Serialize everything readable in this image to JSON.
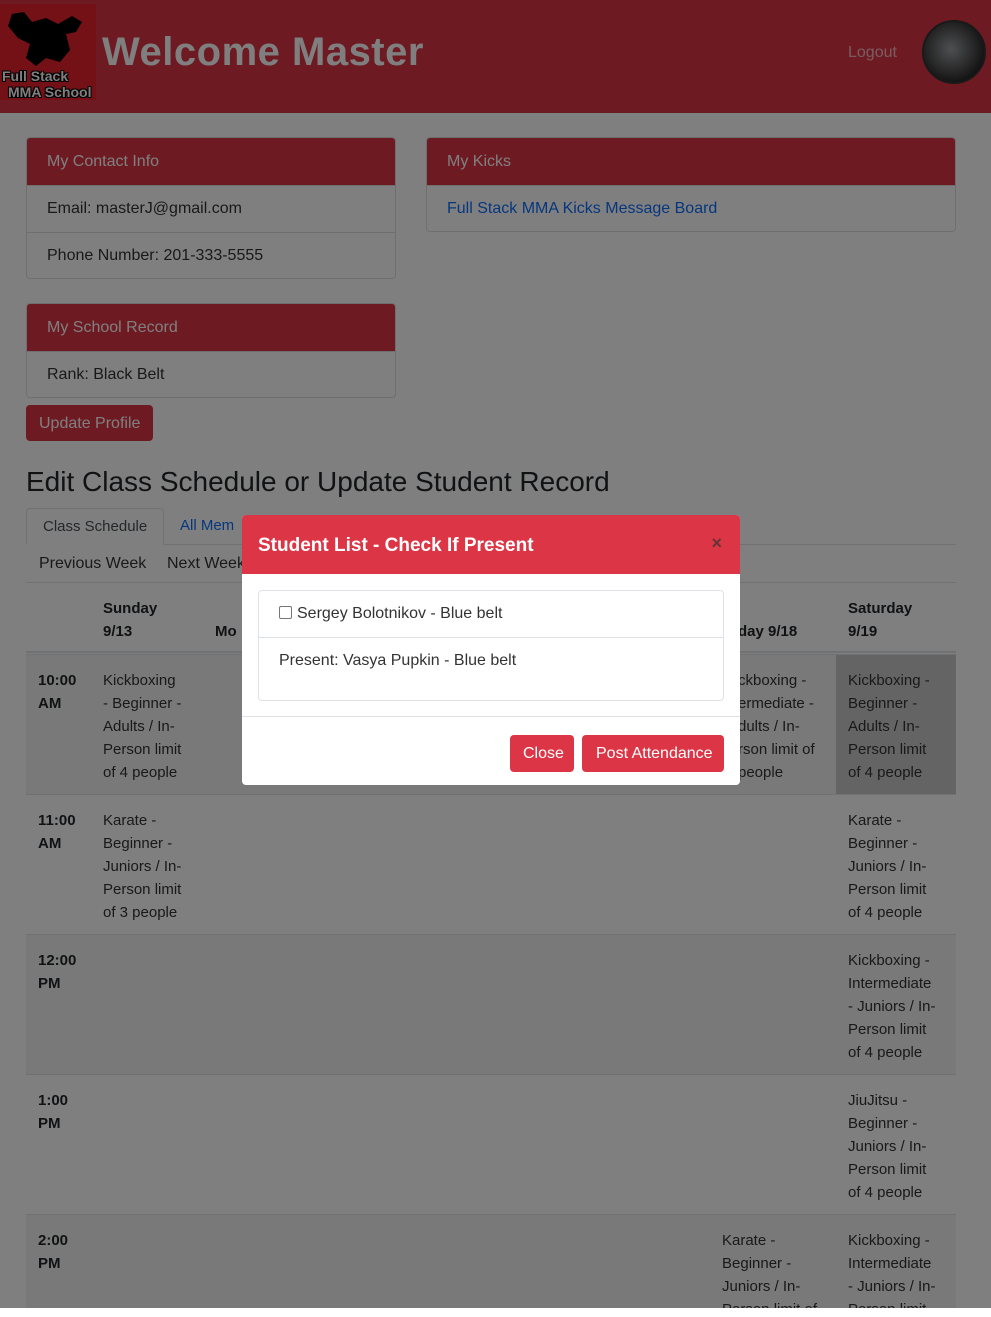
{
  "header": {
    "logo_line1": "Full Stack",
    "logo_line2": "MMA School",
    "welcome": "Welcome Master",
    "logout": "Logout"
  },
  "contact": {
    "title": "My Contact Info",
    "email": "Email: masterJ@gmail.com",
    "phone": "Phone Number: 201-333-5555"
  },
  "kicks": {
    "title": "My Kicks",
    "link": "Full Stack MMA Kicks Message Board"
  },
  "record": {
    "title": "My School Record",
    "rank": "Rank: Black Belt"
  },
  "update_profile": "Update Profile",
  "section_title": "Edit Class Schedule or Update Student Record",
  "tabs": [
    "Class Schedule",
    "All Mem"
  ],
  "week_nav": {
    "prev": "Previous Week",
    "next": "Next Week"
  },
  "schedule": {
    "days": [
      {
        "line1": "Sunday",
        "line2": "9/13"
      },
      {
        "line1": "Mo",
        "line2": ""
      },
      {
        "line1": "",
        "line2": "day 9/18"
      },
      {
        "line1": "Saturday",
        "line2": "9/19"
      }
    ],
    "times": [
      {
        "l1": "10:00",
        "l2": "AM"
      },
      {
        "l1": "11:00",
        "l2": "AM"
      },
      {
        "l1": "12:00",
        "l2": "PM"
      },
      {
        "l1": "1:00",
        "l2": "PM"
      },
      {
        "l1": "2:00",
        "l2": "PM"
      }
    ],
    "cells": {
      "r1_sun": [
        "Kickboxing",
        "- Beginner -",
        "Adults / In-",
        "Person limit",
        "of 4 people"
      ],
      "r1_fri": [
        "ckboxing -",
        "ermediate -",
        "dults / In-",
        "rson limit of",
        "people"
      ],
      "r1_sat": [
        "Kickboxing -",
        "Beginner -",
        "Adults / In-",
        "Person limit",
        "of 4 people"
      ],
      "r2_sun": [
        "Karate -",
        "Beginner -",
        "Juniors / In-",
        "Person limit",
        "of 3 people"
      ],
      "r2_sat": [
        "Karate -",
        "Beginner -",
        "Juniors / In-",
        "Person limit",
        "of 4 people"
      ],
      "r3_sat": [
        "Kickboxing -",
        "Intermediate",
        "- Juniors / In-",
        "Person limit",
        "of 4 people"
      ],
      "r4_sat": [
        "JiuJitsu -",
        "Beginner -",
        "Juniors / In-",
        "Person limit",
        "of 4 people"
      ],
      "r5_fri": [
        "Karate -",
        "Beginner -",
        "Juniors / In-",
        "Person limit of"
      ],
      "r5_sat": [
        "Kickboxing -",
        "Intermediate",
        "- Juniors / In-",
        "Person limit"
      ]
    }
  },
  "modal": {
    "title": "Student List - Check If Present",
    "close_x": "×",
    "student_unchecked": "Sergey Bolotnikov - Blue belt",
    "present": "Present: Vasya Pupkin - Blue belt",
    "close_btn": "Close",
    "post_btn": "Post Attendance"
  }
}
